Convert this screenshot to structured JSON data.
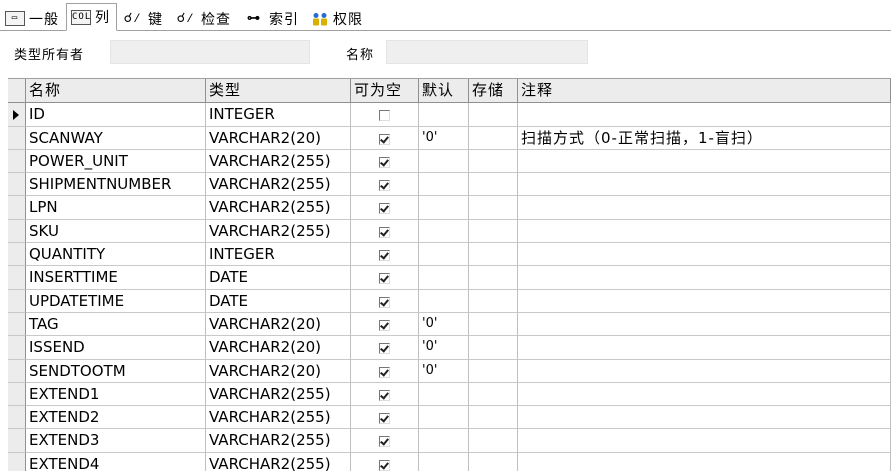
{
  "tabs": [
    {
      "label": "一般",
      "icon": "general-icon",
      "active": false
    },
    {
      "label": "列",
      "icon": "columns-icon",
      "active": true
    },
    {
      "label": "键",
      "icon": "key-icon",
      "active": false
    },
    {
      "label": "检查",
      "icon": "check-icon",
      "active": false
    },
    {
      "label": "索引",
      "icon": "index-icon",
      "active": false
    },
    {
      "label": "权限",
      "icon": "users-icon",
      "active": false
    }
  ],
  "meta": {
    "owner_label": "类型所有者",
    "owner_value": "",
    "name_label": "名称",
    "name_value": ""
  },
  "grid": {
    "headers": [
      "名称",
      "类型",
      "可为空",
      "默认",
      "存储",
      "注释"
    ],
    "rows": [
      {
        "name": "ID",
        "type": "INTEGER",
        "nullable": false,
        "default": "",
        "storage": "",
        "comment": ""
      },
      {
        "name": "SCANWAY",
        "type": "VARCHAR2(20)",
        "nullable": true,
        "default": "'0'",
        "storage": "",
        "comment": "扫描方式（0-正常扫描，1-盲扫）"
      },
      {
        "name": "POWER_UNIT",
        "type": "VARCHAR2(255)",
        "nullable": true,
        "default": "",
        "storage": "",
        "comment": ""
      },
      {
        "name": "SHIPMENTNUMBER",
        "type": "VARCHAR2(255)",
        "nullable": true,
        "default": "",
        "storage": "",
        "comment": ""
      },
      {
        "name": "LPN",
        "type": "VARCHAR2(255)",
        "nullable": true,
        "default": "",
        "storage": "",
        "comment": ""
      },
      {
        "name": "SKU",
        "type": "VARCHAR2(255)",
        "nullable": true,
        "default": "",
        "storage": "",
        "comment": ""
      },
      {
        "name": "QUANTITY",
        "type": "INTEGER",
        "nullable": true,
        "default": "",
        "storage": "",
        "comment": ""
      },
      {
        "name": "INSERTTIME",
        "type": "DATE",
        "nullable": true,
        "default": "",
        "storage": "",
        "comment": ""
      },
      {
        "name": "UPDATETIME",
        "type": "DATE",
        "nullable": true,
        "default": "",
        "storage": "",
        "comment": ""
      },
      {
        "name": "TAG",
        "type": "VARCHAR2(20)",
        "nullable": true,
        "default": "'0'",
        "storage": "",
        "comment": ""
      },
      {
        "name": "ISSEND",
        "type": "VARCHAR2(20)",
        "nullable": true,
        "default": "'0'",
        "storage": "",
        "comment": ""
      },
      {
        "name": "SENDTOOTM",
        "type": "VARCHAR2(20)",
        "nullable": true,
        "default": "'0'",
        "storage": "",
        "comment": ""
      },
      {
        "name": "EXTEND1",
        "type": "VARCHAR2(255)",
        "nullable": true,
        "default": "",
        "storage": "",
        "comment": ""
      },
      {
        "name": "EXTEND2",
        "type": "VARCHAR2(255)",
        "nullable": true,
        "default": "",
        "storage": "",
        "comment": ""
      },
      {
        "name": "EXTEND3",
        "type": "VARCHAR2(255)",
        "nullable": true,
        "default": "",
        "storage": "",
        "comment": ""
      },
      {
        "name": "EXTEND4",
        "type": "VARCHAR2(255)",
        "nullable": true,
        "default": "",
        "storage": "",
        "comment": ""
      }
    ],
    "current_row": 0
  }
}
